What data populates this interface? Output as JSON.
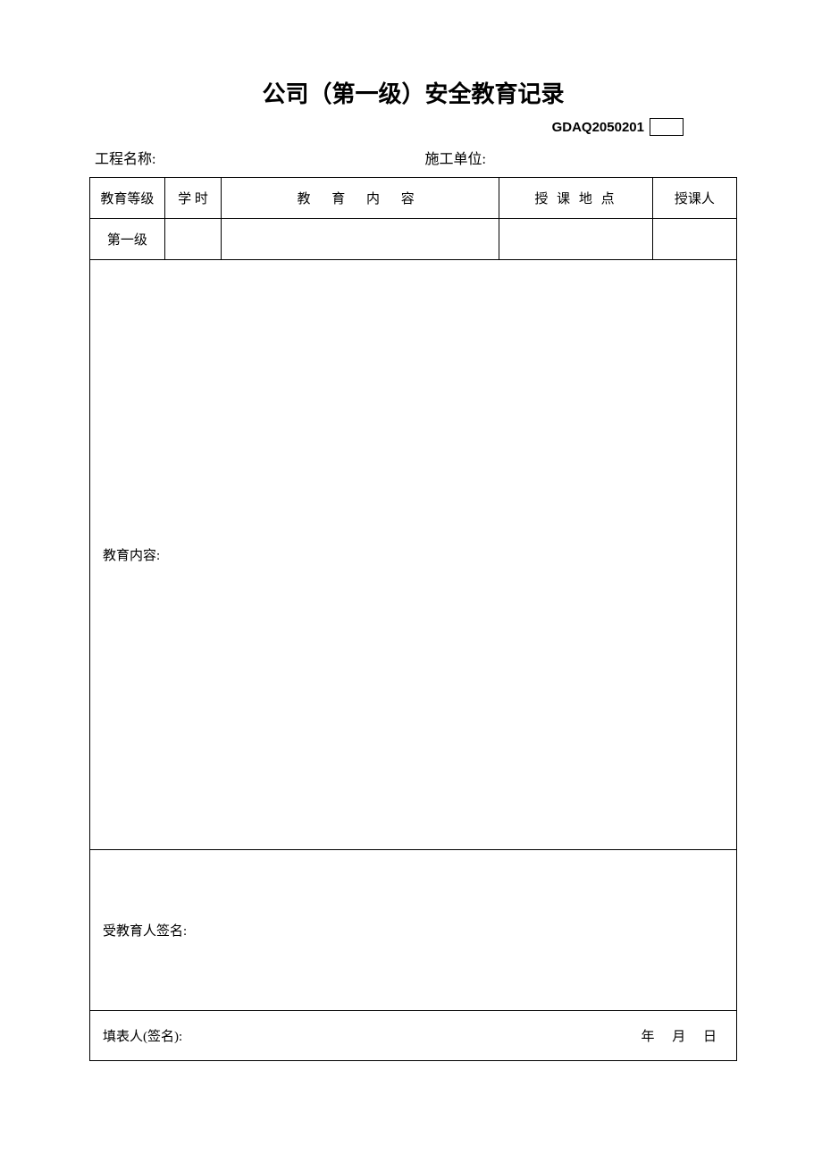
{
  "title": "公司（第一级）安全教育记录",
  "doc_code": "GDAQ2050201",
  "info": {
    "project_label": "工程名称:",
    "unit_label": "施工单位:"
  },
  "table": {
    "headers": {
      "level": "教育等级",
      "hours": "学 时",
      "content": "教 育 内 容",
      "location": "授 课 地 点",
      "teacher": "授课人"
    },
    "row": {
      "level": "第一级",
      "hours": "",
      "content": "",
      "location": "",
      "teacher": ""
    },
    "content_label": "教育内容:",
    "signer_label": "受教育人签名:",
    "footer": {
      "filler_label": "填表人(签名):",
      "year": "年",
      "month": "月",
      "day": "日"
    }
  }
}
